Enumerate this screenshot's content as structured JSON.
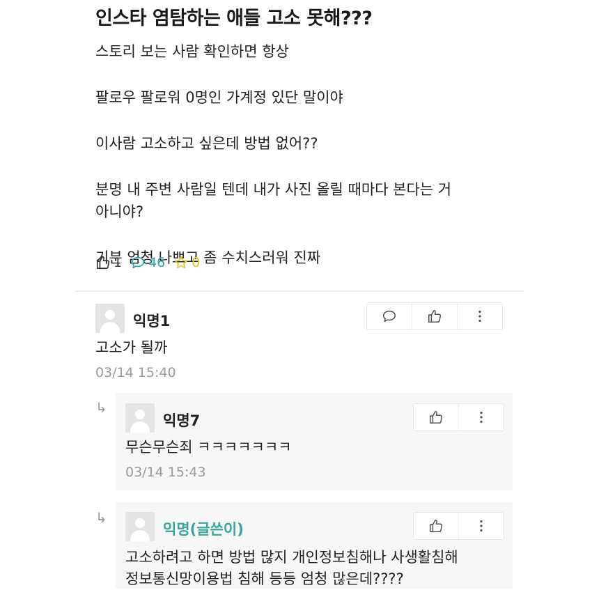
{
  "post": {
    "title": "인스타 염탐하는 애들 고소 못해???",
    "body": [
      "스토리 보는 사람 확인하면 항상",
      "팔로우 팔로워 0명인 가계정 있단 말이야",
      "이사람 고소하고 싶은데 방법 없어??",
      "분명 내 주변 사람일 텐데 내가 사진 올릴 때마다 본다는 거",
      "아니야?",
      "기분 엄청 나쁘고 좀 수치스러워 진짜"
    ],
    "stats": {
      "likes": "1",
      "comments": "46",
      "scraps": "0"
    },
    "colors": {
      "comment_count": "#2aa5a5",
      "scrap_count": "#e3c31a",
      "author_name": "#35a79b"
    }
  },
  "comments": [
    {
      "author": "익명1",
      "text": "고소가 될까",
      "time": "03/14 15:40"
    }
  ],
  "replies": [
    {
      "author": "익명7",
      "text": [
        "무슨무슨죄 ㅋㅋㅋㅋㅋㅋㅋ"
      ],
      "time": "03/14 15:43"
    },
    {
      "author": "익명(글쓴이)",
      "text": [
        "고소하려고 하면 방법 많지 개인정보침해나 사생활침해",
        "정보통신망이용법 침해 등등 엄청 많은데????"
      ]
    }
  ],
  "icons": {
    "like": "thumbs-up-icon",
    "comment": "speech-bubble-icon",
    "scrap": "star-icon",
    "more": "more-vertical-icon",
    "reply": "reply-arrow-icon"
  }
}
